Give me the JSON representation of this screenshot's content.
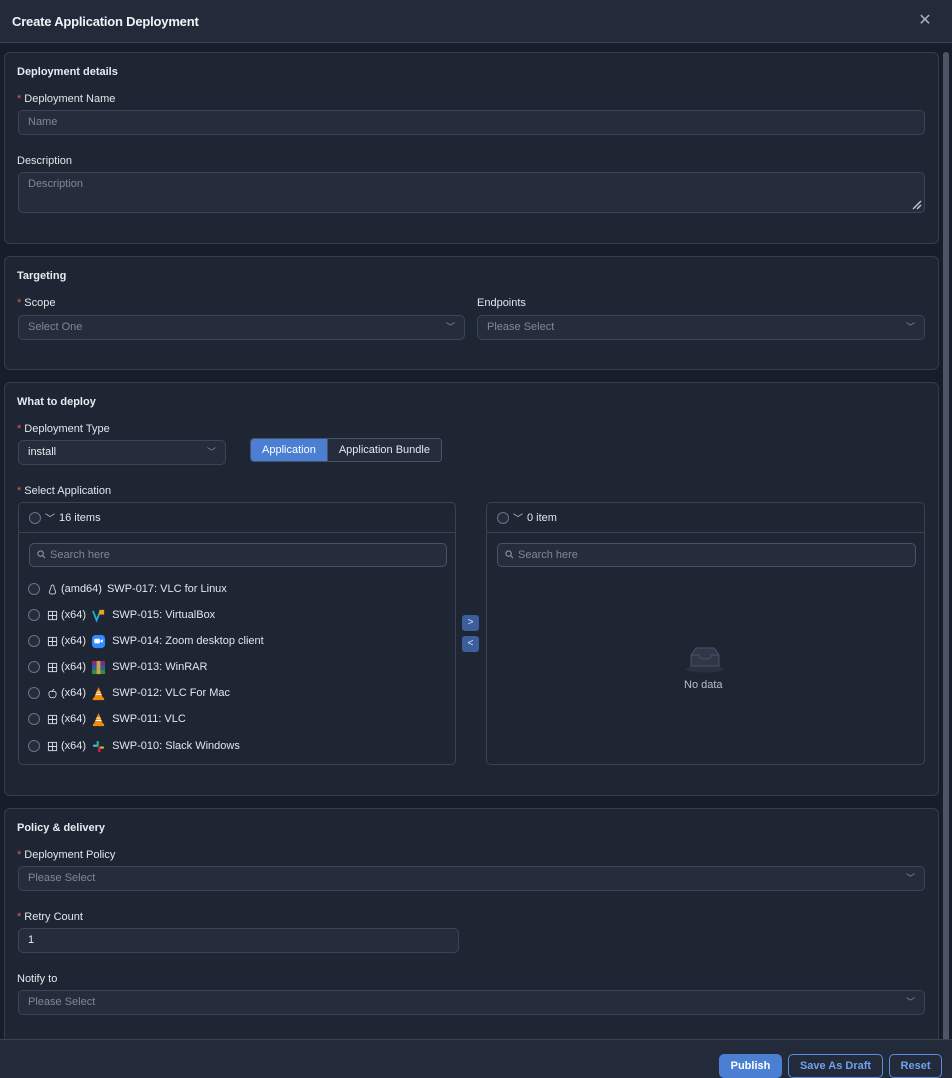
{
  "dialog": {
    "title": "Create Application Deployment"
  },
  "details": {
    "title": "Deployment details",
    "name_label": "Deployment Name",
    "name_placeholder": "Name",
    "description_label": "Description",
    "description_placeholder": "Description"
  },
  "targeting": {
    "title": "Targeting",
    "scope_label": "Scope",
    "scope_placeholder": "Select One",
    "endpoints_label": "Endpoints",
    "endpoints_placeholder": "Please Select"
  },
  "deploy": {
    "title": "What to deploy",
    "type_label": "Deployment Type",
    "type_value": "install",
    "tabs": [
      "Application",
      "Application Bundle"
    ],
    "active_tab": "Application",
    "select_label": "Select Application",
    "source": {
      "count": "16 items",
      "search_placeholder": "Search here",
      "items": [
        {
          "os": "linux-icon",
          "arch": "(amd64)",
          "icon": "vlc-icon",
          "label": "SWP-017: VLC for Linux"
        },
        {
          "os": "windows-icon",
          "arch": "(x64)",
          "icon": "virtualbox-icon",
          "label": "SWP-015: VirtualBox"
        },
        {
          "os": "windows-icon",
          "arch": "(x64)",
          "icon": "zoom-icon",
          "label": "SWP-014: Zoom desktop client"
        },
        {
          "os": "windows-icon",
          "arch": "(x64)",
          "icon": "winrar-icon",
          "label": "SWP-013: WinRAR"
        },
        {
          "os": "apple-icon",
          "arch": "(x64)",
          "icon": "vlc-icon",
          "label": "SWP-012: VLC For Mac"
        },
        {
          "os": "windows-icon",
          "arch": "(x64)",
          "icon": "vlc-icon",
          "label": "SWP-011: VLC"
        },
        {
          "os": "windows-icon",
          "arch": "(x64)",
          "icon": "slack-icon",
          "label": "SWP-010: Slack Windows"
        }
      ]
    },
    "target": {
      "count": "0 item",
      "search_placeholder": "Search here",
      "empty_text": "No data"
    }
  },
  "policy": {
    "title": "Policy & delivery",
    "policy_label": "Deployment Policy",
    "policy_placeholder": "Please Select",
    "retry_label": "Retry Count",
    "retry_value": "1",
    "notify_label": "Notify to",
    "notify_placeholder": "Please Select"
  },
  "footer": {
    "publish": "Publish",
    "draft": "Save As Draft",
    "reset": "Reset"
  },
  "colors": {
    "accent": "#4a7fd4",
    "required": "#e6584f",
    "background": "#171d29",
    "card": "#1e2533"
  }
}
